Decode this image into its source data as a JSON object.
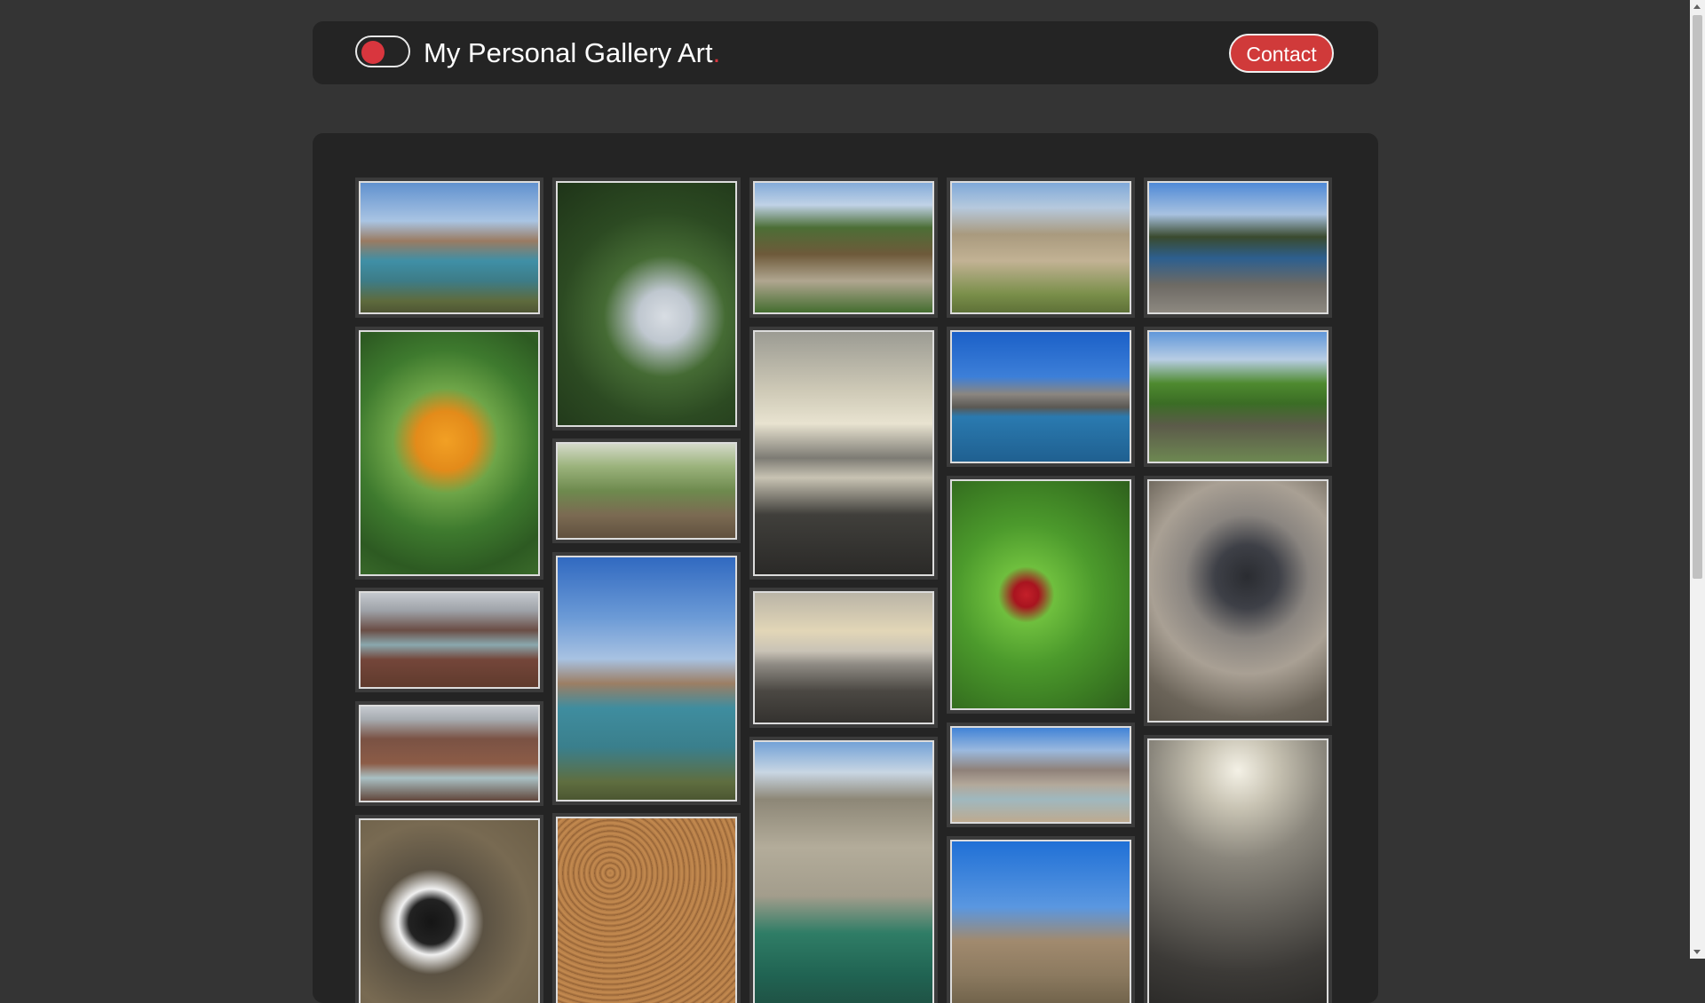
{
  "header": {
    "title": "My Personal Gallery Art",
    "title_dot": ".",
    "contact_label": "Contact",
    "toggle_state": "off"
  },
  "colors": {
    "page_bg": "#343434",
    "panel_bg": "#242424",
    "accent": "#d9363e",
    "text": "#ffffff"
  },
  "gallery": {
    "photos": [
      {
        "subject": "canyon lake under blue sky"
      },
      {
        "subject": "tree canopy from below"
      },
      {
        "subject": "stream with rocks and grass"
      },
      {
        "subject": "rocky canyon wall"
      },
      {
        "subject": "river among boulders"
      },
      {
        "subject": "orange pumpkin behind wire fence"
      },
      {
        "subject": "garlic plants in soil"
      },
      {
        "subject": "sunset over ocean shore"
      },
      {
        "subject": "rock formation in blue water"
      },
      {
        "subject": "poplar trees and pond"
      },
      {
        "subject": "red-brown mountains with river"
      },
      {
        "subject": "canyon reservoir panorama"
      },
      {
        "subject": "beach at dusk"
      },
      {
        "subject": "red chili pepper plant"
      },
      {
        "subject": "grey kitten on mat"
      },
      {
        "subject": "mountain slope with river"
      },
      {
        "subject": "crater lake in valley"
      },
      {
        "subject": "high mountain lagoon"
      },
      {
        "subject": "cloudy ocean sunset"
      },
      {
        "subject": "black and white dog with ball"
      },
      {
        "subject": "gravel ground texture"
      },
      {
        "subject": "mountain valley road"
      }
    ]
  },
  "scrollbar": {
    "position_fraction": 0.0
  }
}
